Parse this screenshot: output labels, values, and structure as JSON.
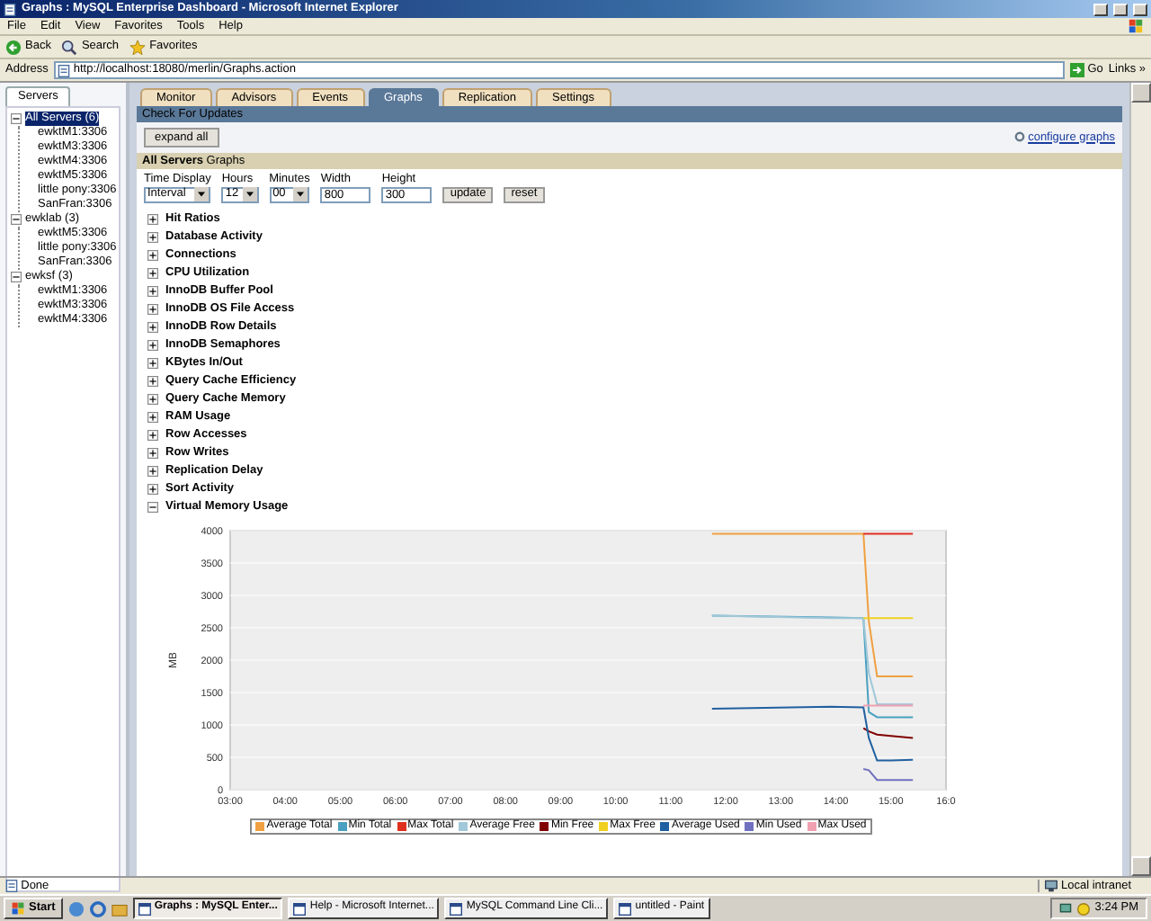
{
  "window": {
    "title": "Graphs : MySQL Enterprise Dashboard - Microsoft Internet Explorer"
  },
  "menu_bar": [
    "File",
    "Edit",
    "View",
    "Favorites",
    "Tools",
    "Help"
  ],
  "toolbar": [
    {
      "label": "Back",
      "kind": "back"
    },
    {
      "label": "Search",
      "kind": "search"
    },
    {
      "label": "Favorites",
      "kind": "favorites"
    }
  ],
  "address_bar": {
    "label": "Address",
    "value": "http://localhost:18080/merlin/Graphs.action",
    "go": "Go",
    "links": "Links »"
  },
  "sidebar": {
    "tab": "Servers",
    "tree": [
      {
        "label": "All Servers (6)",
        "selected": true,
        "expanded": true,
        "children": [
          {
            "label": "ewktM1:3306",
            "selected": false
          },
          {
            "label": "ewktM3:3306",
            "selected": false
          },
          {
            "label": "ewktM4:3306",
            "selected": false
          },
          {
            "label": "ewktM5:3306",
            "selected": false
          },
          {
            "label": "little pony:3306",
            "selected": false
          },
          {
            "label": "SanFran:3306",
            "selected": false
          }
        ]
      },
      {
        "label": "ewklab (3)",
        "selected": false,
        "expanded": true,
        "children": [
          {
            "label": "ewktM5:3306",
            "selected": false
          },
          {
            "label": "little pony:3306",
            "selected": false
          },
          {
            "label": "SanFran:3306",
            "selected": false
          }
        ]
      },
      {
        "label": "ewksf (3)",
        "selected": false,
        "expanded": true,
        "children": [
          {
            "label": "ewktM1:3306",
            "selected": false
          },
          {
            "label": "ewktM3:3306",
            "selected": false
          },
          {
            "label": "ewktM4:3306",
            "selected": false
          }
        ]
      }
    ]
  },
  "tabs": [
    {
      "label": "Monitor",
      "selected": false
    },
    {
      "label": "Advisors",
      "selected": false
    },
    {
      "label": "Events",
      "selected": false
    },
    {
      "label": "Graphs",
      "selected": true
    },
    {
      "label": "Replication",
      "selected": false
    },
    {
      "label": "Settings",
      "selected": false
    }
  ],
  "header_link": "Check For Updates",
  "expand_all": "expand all",
  "configure_link": "configure graphs",
  "section_title": "**All Servers** Graphs",
  "controls": {
    "fields": [
      {
        "label": "Time Display",
        "kind": "select",
        "value": "Interval"
      },
      {
        "label": "Hours",
        "kind": "select",
        "value": "12"
      },
      {
        "label": "Minutes",
        "kind": "select",
        "value": "00"
      },
      {
        "label": "Width",
        "kind": "input",
        "value": "800"
      },
      {
        "label": "Height",
        "kind": "input",
        "value": "300"
      }
    ],
    "buttons": [
      "update",
      "reset"
    ]
  },
  "graphs": [
    {
      "label": "Hit Ratios",
      "expanded": false
    },
    {
      "label": "Database Activity",
      "expanded": false
    },
    {
      "label": "Connections",
      "expanded": false
    },
    {
      "label": "CPU Utilization",
      "expanded": false
    },
    {
      "label": "InnoDB Buffer Pool",
      "expanded": false
    },
    {
      "label": "InnoDB OS File Access",
      "expanded": false
    },
    {
      "label": "InnoDB Row Details",
      "expanded": false
    },
    {
      "label": "InnoDB Semaphores",
      "expanded": false
    },
    {
      "label": "KBytes In/Out",
      "expanded": false
    },
    {
      "label": "Query Cache Efficiency",
      "expanded": false
    },
    {
      "label": "Query Cache Memory",
      "expanded": false
    },
    {
      "label": "RAM Usage",
      "expanded": false
    },
    {
      "label": "Row Accesses",
      "expanded": false
    },
    {
      "label": "Row Writes",
      "expanded": false
    },
    {
      "label": "Replication Delay",
      "expanded": false
    },
    {
      "label": "Sort Activity",
      "expanded": false
    },
    {
      "label": "Virtual Memory Usage",
      "expanded": true,
      "chart_data": {
        "type": "line",
        "grid": true,
        "legend": true,
        "ylabel": "MB",
        "x": [
          11.75,
          13.9,
          14.5,
          14.6,
          14.75,
          15.0,
          15.4
        ],
        "xlim": [
          3,
          16
        ],
        "ylim": [
          0,
          4000
        ],
        "xticks": [
          {
            "value": 3,
            "label": "03:00"
          },
          {
            "value": 4,
            "label": "04:00"
          },
          {
            "value": 5,
            "label": "05:00"
          },
          {
            "value": 6,
            "label": "06:00"
          },
          {
            "value": 7,
            "label": "07:00"
          },
          {
            "value": 8,
            "label": "08:00"
          },
          {
            "value": 9,
            "label": "09:00"
          },
          {
            "value": 10,
            "label": "10:00"
          },
          {
            "value": 11,
            "label": "11:00"
          },
          {
            "value": 12,
            "label": "12:00"
          },
          {
            "value": 13,
            "label": "13:00"
          },
          {
            "value": 14,
            "label": "14:00"
          },
          {
            "value": 15,
            "label": "15:00"
          },
          {
            "value": 16,
            "label": "16:0"
          }
        ],
        "yticks": [
          0,
          500,
          1000,
          1500,
          2000,
          2500,
          3000,
          3500,
          4000
        ],
        "series": [
          {
            "name": "Average Total",
            "color": "#f0a040",
            "values": [
              3950,
              3950,
              3950,
              2600,
              1750,
              1750,
              1750
            ]
          },
          {
            "name": "Min Total",
            "color": "#4aa0c0",
            "values": [
              2690,
              2660,
              2650,
              1200,
              1120,
              1120,
              1120
            ]
          },
          {
            "name": "Max Total",
            "color": "#e03020",
            "values": [
              null,
              null,
              3950,
              3950,
              3950,
              3950,
              3950
            ]
          },
          {
            "name": "Average Free",
            "color": "#a0c8d8",
            "values": [
              2690,
              2650,
              2650,
              1800,
              1320,
              1320,
              1320
            ]
          },
          {
            "name": "Min Free",
            "color": "#800000",
            "values": [
              null,
              null,
              950,
              900,
              850,
              830,
              800
            ]
          },
          {
            "name": "Max Free",
            "color": "#f0d020",
            "values": [
              null,
              null,
              2650,
              2650,
              2650,
              2650,
              2650
            ]
          },
          {
            "name": "Average Used",
            "color": "#2060a0",
            "values": [
              1250,
              1280,
              1270,
              800,
              450,
              450,
              460
            ]
          },
          {
            "name": "Min Used",
            "color": "#7070c0",
            "values": [
              null,
              null,
              320,
              300,
              150,
              150,
              150
            ]
          },
          {
            "name": "Max Used",
            "color": "#f0a0b0",
            "values": [
              null,
              null,
              1300,
              1300,
              1300,
              1300,
              1300
            ]
          }
        ]
      }
    }
  ],
  "status_bar": {
    "text": "Done",
    "zone": "Local intranet"
  },
  "taskbar": {
    "start": "Start",
    "tasks": [
      {
        "label": "Graphs : MySQL Enter...",
        "selected": true
      },
      {
        "label": "Help - Microsoft Internet...",
        "selected": false
      },
      {
        "label": "MySQL Command Line Cli...",
        "selected": false
      },
      {
        "label": "untitled - Paint",
        "selected": false
      }
    ],
    "clock": "3:24 PM"
  }
}
